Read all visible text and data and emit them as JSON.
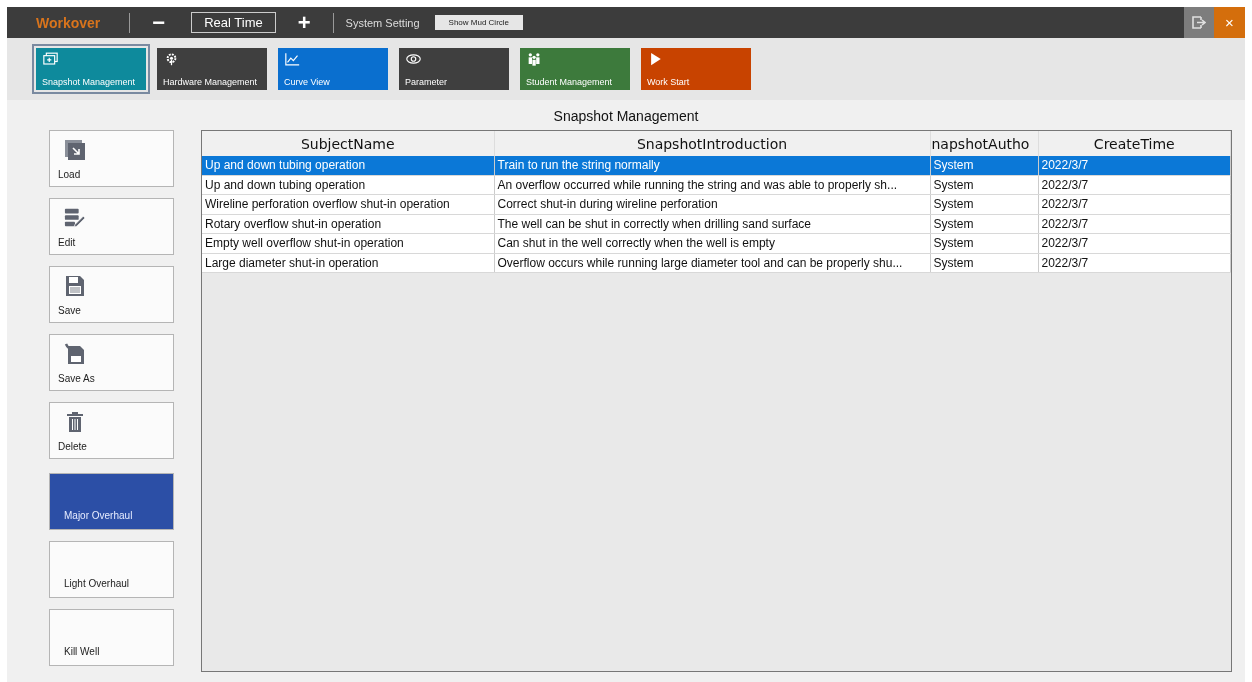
{
  "title_bar": {
    "app_name": "Workover",
    "minus": "−",
    "mode": "Real Time",
    "plus": "+",
    "system_setting": "System Setting",
    "mud_button": "Show Mud Circle",
    "close": "×"
  },
  "modules": [
    {
      "kind": "snapshot",
      "label": "Snapshot Management",
      "color": "#0e8a9c",
      "selected": true
    },
    {
      "kind": "hardware",
      "label": "Hardware Management",
      "color": "#3f3f3f",
      "selected": false
    },
    {
      "kind": "curve",
      "label": "Curve View",
      "color": "#0a6fcf",
      "selected": false
    },
    {
      "kind": "parameter",
      "label": "Parameter",
      "color": "#3f3f3f",
      "selected": false
    },
    {
      "kind": "student",
      "label": "Student Management",
      "color": "#3d7a3c",
      "selected": false
    },
    {
      "kind": "start",
      "label": "Work Start",
      "color": "#c84300",
      "selected": false
    }
  ],
  "page_title": "Snapshot Management",
  "actions": [
    {
      "kind": "load",
      "label": "Load"
    },
    {
      "kind": "edit",
      "label": "Edit"
    },
    {
      "kind": "save",
      "label": "Save"
    },
    {
      "kind": "save_as",
      "label": "Save As"
    },
    {
      "kind": "delete",
      "label": "Delete"
    }
  ],
  "categories": [
    {
      "label": "Major Overhaul",
      "selected": true
    },
    {
      "label": "Light Overhaul",
      "selected": false
    },
    {
      "label": "Kill Well",
      "selected": false
    }
  ],
  "table": {
    "columns": [
      "SubjectName",
      "SnapshotIntroduction",
      "napshotAutho",
      "CreateTime"
    ],
    "rows": [
      {
        "selected": true,
        "cells": [
          "Up and down tubing operation",
          "Train to run the string normally",
          "System",
          "2022/3/7"
        ]
      },
      {
        "selected": false,
        "cells": [
          "Up and down tubing operation",
          "An overflow occurred while running the string and was able to properly sh...",
          "System",
          "2022/3/7"
        ]
      },
      {
        "selected": false,
        "cells": [
          "Wireline perforation overflow shut-in operation",
          "Correct shut-in during wireline perforation",
          "System",
          "2022/3/7"
        ]
      },
      {
        "selected": false,
        "cells": [
          "Rotary overflow shut-in operation",
          "The well can be shut in correctly when drilling sand surface",
          "System",
          "2022/3/7"
        ]
      },
      {
        "selected": false,
        "cells": [
          "Empty well overflow shut-in operation",
          "Can shut in the well correctly when the well is empty",
          "System",
          "2022/3/7"
        ]
      },
      {
        "selected": false,
        "cells": [
          "Large diameter shut-in operation",
          "Overflow occurs while running large diameter tool and can be properly shu...",
          "System",
          "2022/3/7"
        ]
      }
    ]
  }
}
